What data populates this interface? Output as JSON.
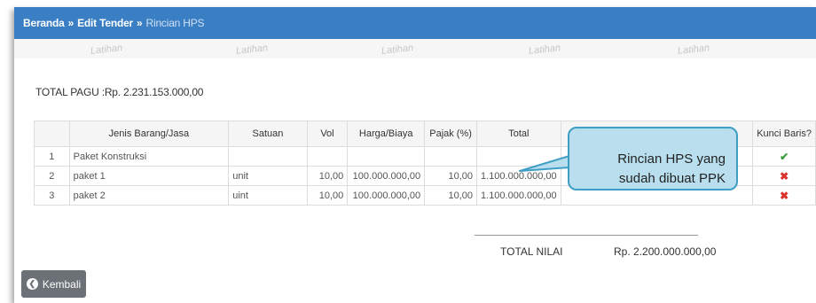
{
  "breadcrumb": {
    "home": "Beranda",
    "sep": "»",
    "parent": "Edit Tender",
    "current": "Rincian HPS"
  },
  "watermark": "Latihan",
  "total_pagu": "TOTAL PAGU :Rp. 2.231.153.000,00",
  "table": {
    "headers": [
      "",
      "Jenis Barang/Jasa",
      "Satuan",
      "Vol",
      "Harga/Biaya",
      "Pajak (%)",
      "Total",
      "",
      "Kunci Baris?"
    ],
    "rows": [
      {
        "no": "1",
        "jenis": "Paket Konstruksi",
        "satuan": "",
        "vol": "",
        "harga": "",
        "pajak": "",
        "total": "",
        "ket": "",
        "kunci": "check"
      },
      {
        "no": "2",
        "jenis": "paket 1",
        "satuan": "unit",
        "vol": "10,00",
        "harga": "100.000.000,00",
        "pajak": "10,00",
        "total": "1.100.000.000,00",
        "ket": "",
        "kunci": "cross"
      },
      {
        "no": "3",
        "jenis": "paket 2",
        "satuan": "uint",
        "vol": "10,00",
        "harga": "100.000.000,00",
        "pajak": "10,00",
        "total": "1.100.000.000,00",
        "ket": "",
        "kunci": "cross"
      }
    ]
  },
  "total_nilai": {
    "label": "TOTAL NILAI",
    "value": "Rp. 2.200.000.000,00"
  },
  "back_button": {
    "label": "Kembali",
    "icon": "circle-chevron-left-icon"
  },
  "callout": {
    "line1": "Rincian HPS yang",
    "line2": "sudah dibuat PPK"
  },
  "icons": {
    "check": "✔",
    "cross": "✖"
  },
  "colors": {
    "topbar": "#3a7fc4",
    "check": "#3c9c3c",
    "cross": "#d9342b",
    "callout_fill": "#b9dfef",
    "callout_border": "#3e9ec4"
  }
}
